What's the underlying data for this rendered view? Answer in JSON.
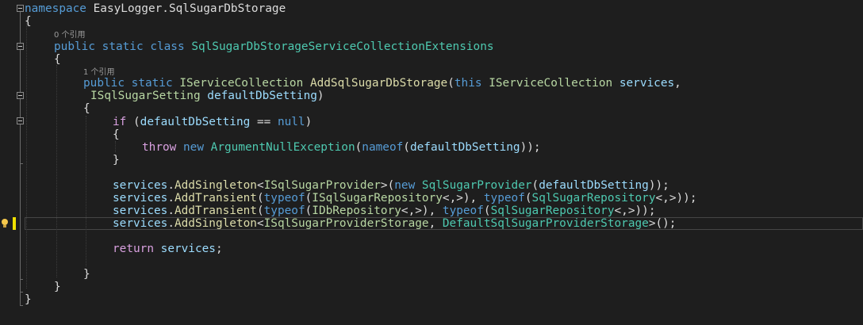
{
  "colors": {
    "background": "#1e1e1e",
    "keyword": "#569cd6",
    "control_keyword": "#d8a0df",
    "class": "#4ec9b0",
    "interface": "#b8d7a3",
    "method": "#dcdcaa",
    "parameter": "#9cdcfe",
    "default_text": "#dcdcdc",
    "codelens": "#999999",
    "change_marker": "#f0e000"
  },
  "icons": {
    "lightbulb": "lightbulb-icon",
    "fold": "collapse-box-icon"
  },
  "codelens": {
    "class_refs": "0 个引用",
    "method_refs": "1 个引用"
  },
  "code": {
    "l1": {
      "a": "namespace",
      "b": " EasyLogger.SqlSugarDbStorage"
    },
    "l2": "{",
    "l3": {
      "a": "public",
      "b": " ",
      "c": "static",
      "d": " ",
      "e": "class",
      "f": " ",
      "g": "SqlSugarDbStorageServiceCollectionExtensions"
    },
    "l4": "{",
    "l5": {
      "a": "public",
      "b": " ",
      "c": "static",
      "d": " ",
      "e": "IServiceCollection",
      "f": " ",
      "g": "AddSqlSugarDbStorage",
      "h": "(",
      "i": "this",
      "j": " ",
      "k": "IServiceCollection",
      "l": " ",
      "m": "services",
      "n": ","
    },
    "l6": {
      "a": "ISqlSugarSetting",
      "b": " ",
      "c": "defaultDbSetting",
      "d": ")"
    },
    "l7": "{",
    "l8": {
      "a": "if",
      "b": " (",
      "c": "defaultDbSetting",
      "d": " == ",
      "e": "null",
      "f": ")"
    },
    "l9": "{",
    "l10": {
      "a": "throw",
      "b": " ",
      "c": "new",
      "d": " ",
      "e": "ArgumentNullException",
      "f": "(",
      "g": "nameof",
      "h": "(",
      "i": "defaultDbSetting",
      "j": "));"
    },
    "l11": "}",
    "l12": {
      "a": "services",
      "b": ".",
      "c": "AddSingleton",
      "d": "<",
      "e": "ISqlSugarProvider",
      "f": ">(",
      "g": "new",
      "h": " ",
      "i": "SqlSugarProvider",
      "j": "(",
      "k": "defaultDbSetting",
      "l": "));"
    },
    "l13": {
      "a": "services",
      "b": ".",
      "c": "AddTransient",
      "d": "(",
      "e": "typeof",
      "f": "(",
      "g": "ISqlSugarRepository",
      "h": "<,>), ",
      "i": "typeof",
      "j": "(",
      "k": "SqlSugarRepository",
      "l": "<,>));"
    },
    "l14": {
      "a": "services",
      "b": ".",
      "c": "AddTransient",
      "d": "(",
      "e": "typeof",
      "f": "(",
      "g": "IDbRepository",
      "h": "<,>), ",
      "i": "typeof",
      "j": "(",
      "k": "SqlSugarRepository",
      "l": "<,>));"
    },
    "l15": {
      "a": "services",
      "b": ".",
      "c": "AddSingleton",
      "d": "<",
      "e": "ISqlSugarProviderStorage",
      "f": ", ",
      "g": "DefaultSqlSugarProviderStorage",
      "h": ">();"
    },
    "l16": {
      "a": "return",
      "b": " ",
      "c": "services",
      "d": ";"
    },
    "l17": "}",
    "l18": "}",
    "l19": "}"
  }
}
